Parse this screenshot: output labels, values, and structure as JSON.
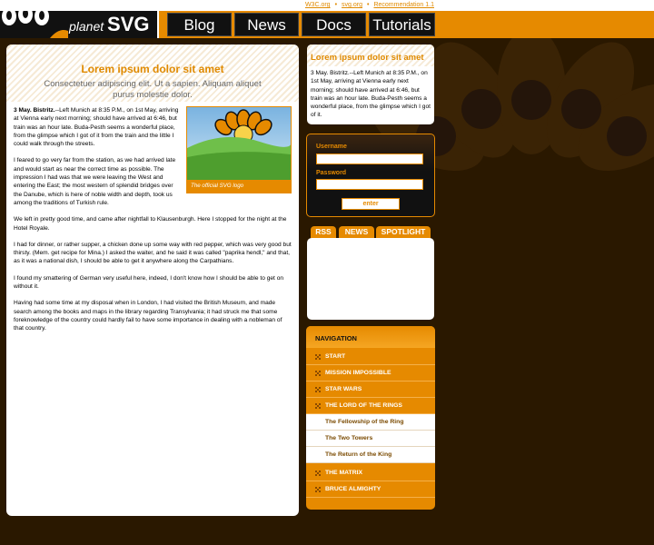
{
  "top_links": [
    "W3C.org",
    "svg.org",
    "Recommendation 1.1"
  ],
  "logo": {
    "small": "planet",
    "big": "SVG"
  },
  "nav_tabs": [
    "Blog",
    "News",
    "Docs",
    "Tutorials"
  ],
  "main": {
    "title": "Lorem ipsum dolor sit amet",
    "subtitle": "Consectetuer adipiscing elit. Ut a sapien. Aliquam aliquet purus molestie dolor.",
    "figure_caption": "The official SVG logo",
    "p1_lead": "3 May. Bistritz.",
    "p1": "--Left Munich at 8:35 P.M., on 1st May, arriving at Vienna early next morning; should have arrived at 6:46, but train was an hour late.  Buda-Pesth seems a wonderful place, from the glimpse which I got of it from the train and the little I could walk through the streets.",
    "p2": "I feared to go very far from the station, as we had arrived late and would start as near the correct time as possible.  The impression I had was that we were leaving the West and entering the East; the most western of splendid bridges over the Danube, which is here of noble width and depth, took us among the traditions of Turkish rule.",
    "p3": "We left in pretty good time, and came after nightfall to Klausenburgh. Here I stopped for the night at the Hotel Royale.",
    "p4": "I had for dinner, or rather supper, a chicken done up some way with red pepper, which was very good but thirsty.  (Mem. get recipe for Mina.) I asked the waiter, and he said it was called \"paprika hendl,\" and that, as it was a national dish, I should be able to get it anywhere along the Carpathians.",
    "p5": "I found my smattering of German very useful here, indeed, I don't know how I should be able to get on without it.",
    "p6": "Having had some time at my disposal when in London, I had visited the British Museum, and made search among the books and maps in the library regarding Transylvania; it had struck me that some foreknowledge of the country could hardly fail to have some importance in dealing with a nobleman of that country."
  },
  "news": {
    "title": "Lorem ipsum dolor sit amet",
    "text": "3 May. Bistritz.--Left Munich at 8:35 P.M., on 1st May, arriving at Vienna early next morning; should have arrived at 6:46, but train was an hour late. Buda-Pesth seems a wonderful place, from the glimpse which I got of it."
  },
  "login": {
    "username_label": "Username",
    "password_label": "Password",
    "button": "enter",
    "username_value": "",
    "password_value": ""
  },
  "tabs": [
    "RSS",
    "NEWS",
    "SPOTLIGHT"
  ],
  "navigation": {
    "title": "NAVIGATION",
    "items": [
      {
        "label": "START",
        "level": "top"
      },
      {
        "label": "MISSION IMPOSSIBLE",
        "level": "top"
      },
      {
        "label": "STAR WARS",
        "level": "top"
      },
      {
        "label": "THE LORD OF THE RINGS",
        "level": "top"
      },
      {
        "label": "The Fellowship of the Ring",
        "level": "sub"
      },
      {
        "label": "The Two Towers",
        "level": "sub"
      },
      {
        "label": "The Return of the King",
        "level": "sub"
      },
      {
        "label": "THE MATRIX",
        "level": "top"
      },
      {
        "label": "BRUCE ALMIGHTY",
        "level": "top"
      }
    ]
  },
  "colors": {
    "accent": "#e68a00",
    "dark": "#2a1800",
    "link": "#e08a00"
  },
  "icons": [
    "svg-logo-icon",
    "nav-bullet-icon",
    "svg-flower-logo"
  ]
}
